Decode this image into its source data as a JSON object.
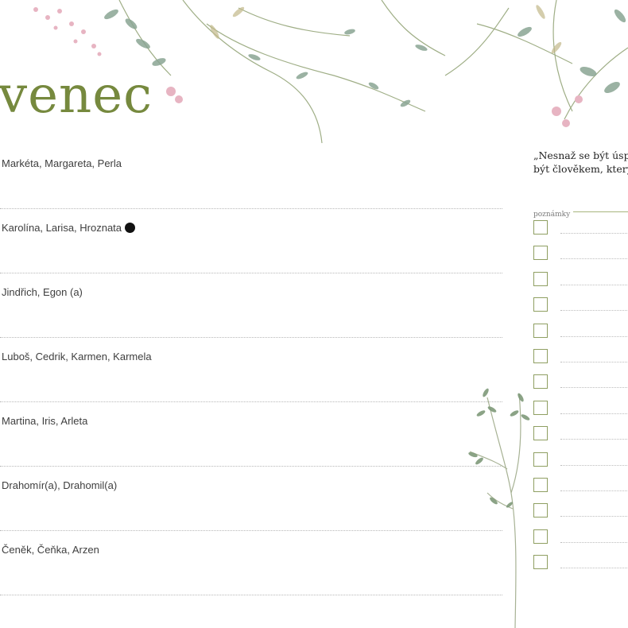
{
  "header": {
    "month_title": "venec"
  },
  "days": [
    {
      "names": "Markéta, Margareta, Perla",
      "marked": false
    },
    {
      "names": "Karolína, Larisa, Hroznata",
      "marked": true
    },
    {
      "names": "Jindřich, Egon (a)",
      "marked": false
    },
    {
      "names": "Luboš, Cedrik, Karmen, Karmela",
      "marked": false
    },
    {
      "names": "Martina, Iris, Arleta",
      "marked": false
    },
    {
      "names": "Drahomír(a), Drahomil(a)",
      "marked": false
    },
    {
      "names": "Čeněk, Čeňka, Arzen",
      "marked": false
    }
  ],
  "quote": {
    "line1": "„Nesnaž se být úspěš",
    "line2": "být člověkem, který z"
  },
  "notes": {
    "label": "poznámky",
    "checkbox_count": 14
  },
  "colors": {
    "title": "#76893e",
    "accent": "#8f9f62",
    "leaf": "#7f9a7a",
    "blossom": "#e7b4c2"
  }
}
